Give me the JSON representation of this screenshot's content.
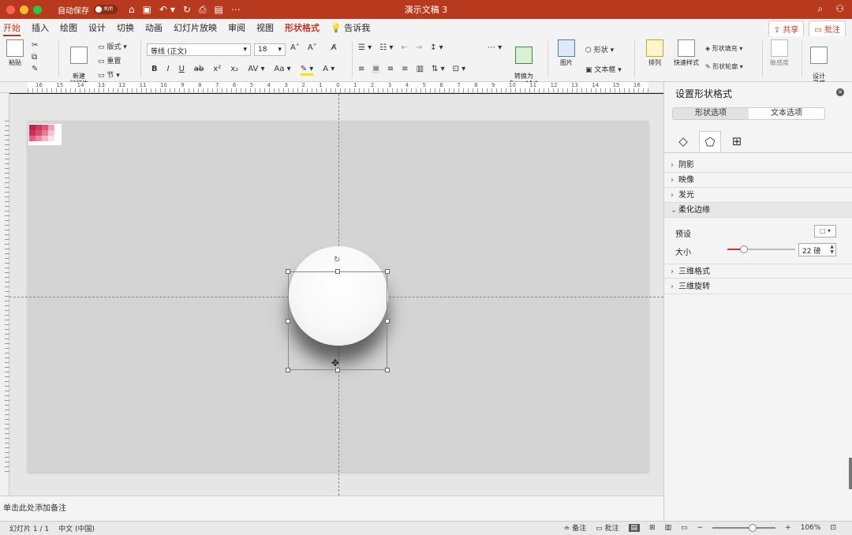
{
  "window": {
    "title": "演示文稿 3",
    "autosave_label": "自动保存",
    "autosave_state": "关闭",
    "colors": {
      "titlebar": "#b83a1e",
      "close": "#ff5f57",
      "min": "#febc2e",
      "max": "#28c840"
    }
  },
  "tabs": [
    {
      "label": "开始"
    },
    {
      "label": "插入"
    },
    {
      "label": "绘图"
    },
    {
      "label": "设计"
    },
    {
      "label": "切换"
    },
    {
      "label": "动画"
    },
    {
      "label": "幻灯片放映"
    },
    {
      "label": "审阅"
    },
    {
      "label": "视图"
    },
    {
      "label": "形状格式"
    },
    {
      "label": "告诉我"
    }
  ],
  "share": {
    "share_label": "共享",
    "comment_label": "批注"
  },
  "ribbon": {
    "paste": "粘贴",
    "new_slide": "新建\n幻灯片",
    "layout": "版式",
    "reset": "重置",
    "section": "节",
    "font_name": "等线 (正文)",
    "font_size": "18",
    "convert_smartart": "转换为\nSmartArt",
    "picture": "图片",
    "shape": "形状",
    "textbox": "文本框",
    "arrange": "排列",
    "quick_styles": "快速样式",
    "shape_fill": "形状填充",
    "shape_outline": "形状轮廓",
    "sensitivity": "敏感度",
    "designer": "设计\n灵感"
  },
  "ruler_numbers": [
    "16",
    "15",
    "14",
    "13",
    "12",
    "11",
    "10",
    "9",
    "8",
    "7",
    "6",
    "5",
    "4",
    "3",
    "2",
    "1",
    "0",
    "1",
    "2",
    "3",
    "4",
    "5",
    "6",
    "7",
    "8",
    "9",
    "10",
    "11",
    "12",
    "13",
    "14",
    "15",
    "16"
  ],
  "notes_placeholder": "单击此处添加备注",
  "status": {
    "slide_counter": "幻灯片 1 / 1",
    "language": "中文 (中国)",
    "notes_btn": "备注",
    "comments_btn": "批注",
    "zoom": "106%"
  },
  "pane": {
    "title": "设置形状格式",
    "tab_shape": "形状选项",
    "tab_text": "文本选项",
    "sections": {
      "shadow": "阴影",
      "reflection": "映像",
      "glow": "发光",
      "soft_edges": "柔化边缘",
      "format_3d": "三维格式",
      "rotation_3d": "三维旋转"
    },
    "preset_label": "预设",
    "size_label": "大小",
    "size_value": "22 磅"
  },
  "swatch_colors": [
    "#b8244b",
    "#c93a5d",
    "#d8587a",
    "#eda0b4",
    "#c83055",
    "#d64d70",
    "#e57c98",
    "#f5c3d0",
    "#e0607f",
    "#e98aa3",
    "#f3b7c7",
    "#fbe0e7"
  ]
}
